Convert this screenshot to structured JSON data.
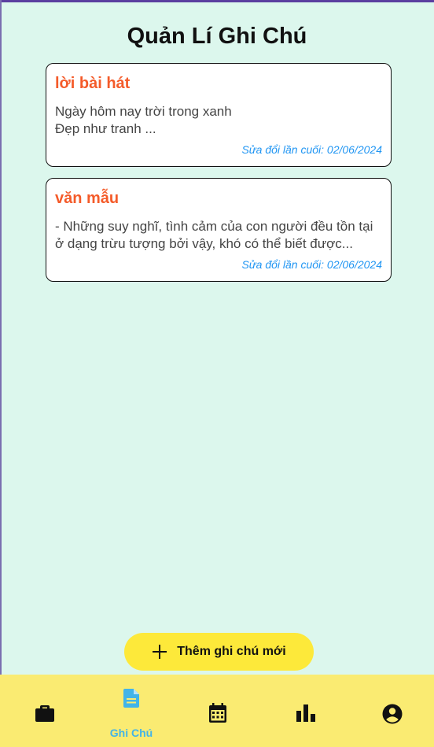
{
  "header": {
    "title": "Quản Lí Ghi Chú"
  },
  "notes": [
    {
      "title": "lời bài hát",
      "content": "Ngày hôm nay trời trong xanh\nĐẹp như tranh ...",
      "modified": "Sửa đổi lần cuối: 02/06/2024"
    },
    {
      "title": "văn mẫu",
      "content": "- Những suy nghĩ, tình cảm của con người đều tồn tại ở dạng trừu tượng bởi vậy, khó có thể biết được...",
      "modified": "Sửa đổi lần cuối: 02/06/2024"
    }
  ],
  "add_button": {
    "label": "Thêm ghi chú mới",
    "icon": "plus-icon"
  },
  "bottom_nav": {
    "items": [
      {
        "icon": "briefcase-icon",
        "label": ""
      },
      {
        "icon": "note-icon",
        "label": "Ghi Chú",
        "active": true
      },
      {
        "icon": "calendar-icon",
        "label": ""
      },
      {
        "icon": "bar-chart-icon",
        "label": ""
      },
      {
        "icon": "account-icon",
        "label": ""
      }
    ]
  },
  "colors": {
    "background": "#dcf7ed",
    "note_title": "#f45b2a",
    "modified_text": "#2196f3",
    "accent_button": "#fde93a",
    "bottom_nav": "#faeb72",
    "active_nav": "#42b4e8"
  }
}
